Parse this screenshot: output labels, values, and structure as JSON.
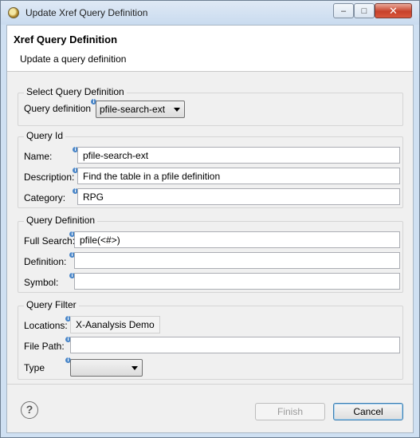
{
  "window": {
    "title": "Update Xref Query Definition",
    "minimize": "‒",
    "maximize": "□",
    "close": "✕"
  },
  "banner": {
    "title": "Xref Query Definition",
    "description": "Update a query definition"
  },
  "select_group": {
    "title": "Select Query Definition",
    "query_definition_label": "Query definition",
    "query_definition_value": "pfile-search-ext"
  },
  "query_id_group": {
    "title": "Query Id",
    "name_label": "Name:",
    "name_value": "pfile-search-ext",
    "description_label": "Description:",
    "description_value": "Find the table in a pfile definition",
    "category_label": "Category:",
    "category_value": "RPG"
  },
  "query_definition_group": {
    "title": "Query Definition",
    "full_search_label": "Full Search:",
    "full_search_value": "pfile(<#>)",
    "definition_label": "Definition:",
    "definition_value": "",
    "symbol_label": "Symbol:",
    "symbol_value": ""
  },
  "query_filter_group": {
    "title": "Query Filter",
    "locations_label": "Locations:",
    "locations_value": "X-Aanalysis Demo",
    "file_path_label": "File Path:",
    "file_path_value": "",
    "type_label": "Type",
    "type_value": ""
  },
  "footer": {
    "help": "?",
    "finish_label": "Finish",
    "cancel_label": "Cancel"
  },
  "icons": {
    "info": "i"
  }
}
